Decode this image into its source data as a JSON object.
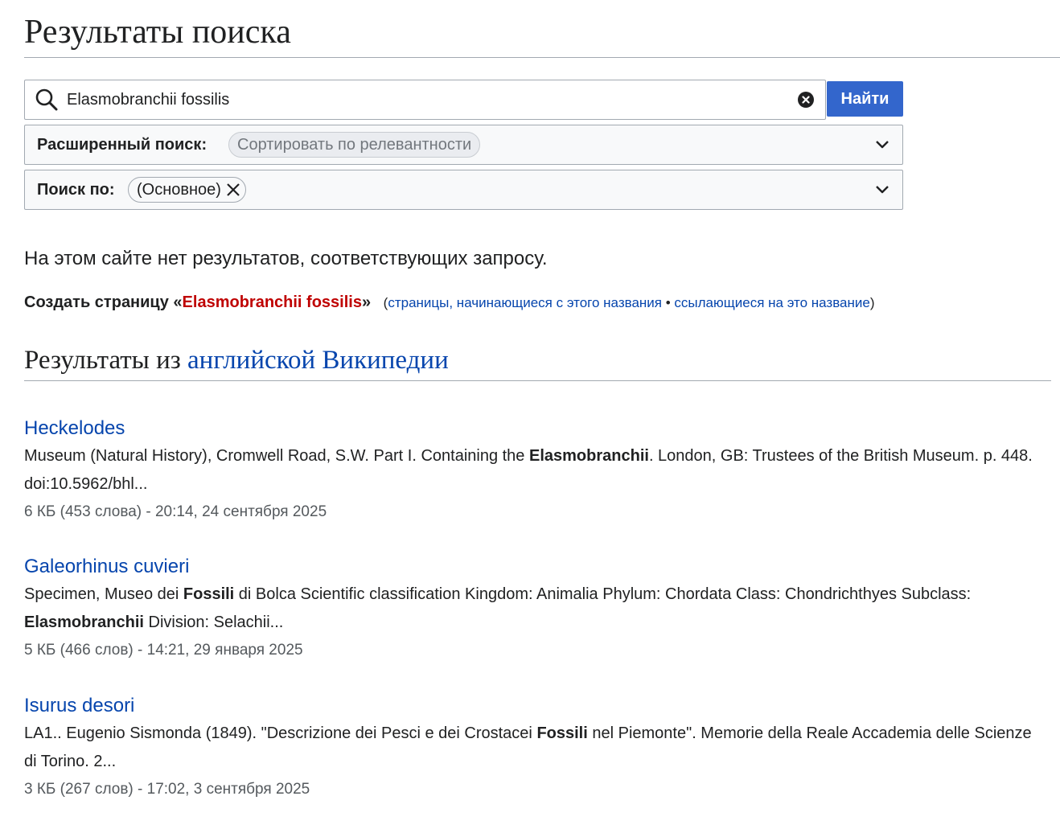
{
  "page": {
    "title": "Результаты поиска"
  },
  "search": {
    "query": "Elasmobranchii fossilis",
    "button_label": "Найти"
  },
  "advanced": {
    "label": "Расширенный поиск:",
    "sort_chip": "Сортировать по релевантности"
  },
  "namespace": {
    "label": "Поиск по:",
    "chip": "(Основное)"
  },
  "notice": {
    "no_results": "На этом сайте нет результатов, соответствующих запросу.",
    "create_prefix": "Создать страницу «",
    "create_title": "Elasmobranchii fossilis",
    "create_suffix": "»",
    "paren_open": "(",
    "link_prefix": "страницы, начинающиеся с этого названия",
    "separator": " • ",
    "link_links": "ссылающиеся на это название",
    "paren_close": ")"
  },
  "interwiki": {
    "prefix": "Результаты из ",
    "link": "английской Википедии"
  },
  "results": [
    {
      "title": "Heckelodes",
      "snippet": [
        {
          "t": "Museum (Natural History), Cromwell Road, S.W. Part I. Containing the ",
          "b": false
        },
        {
          "t": "Elasmobranchii",
          "b": true
        },
        {
          "t": ". London, GB: Trustees of the British Museum. p. 448. doi:10.5962/bhl...",
          "b": false
        }
      ],
      "meta": "6 КБ (453 слова) - 20:14, 24 сентября 2025"
    },
    {
      "title": "Galeorhinus cuvieri",
      "snippet": [
        {
          "t": "Specimen, Museo dei ",
          "b": false
        },
        {
          "t": "Fossili",
          "b": true
        },
        {
          "t": " di Bolca Scientific classification Kingdom: Animalia Phylum: Chordata Class: Chondrichthyes Subclass: ",
          "b": false
        },
        {
          "t": "Elasmobranchii",
          "b": true
        },
        {
          "t": " Division: Selachii...",
          "b": false
        }
      ],
      "meta": "5 КБ (466 слов) - 14:21, 29 января 2025"
    },
    {
      "title": "Isurus desori",
      "snippet": [
        {
          "t": "LA1.. Eugenio Sismonda (1849). \"Descrizione dei Pesci e dei Crostacei ",
          "b": false
        },
        {
          "t": "Fossili",
          "b": true
        },
        {
          "t": " nel Piemonte\". Memorie della Reale Accademia delle Scienze di Torino. 2...",
          "b": false
        }
      ],
      "meta": "3 КБ (267 слов) - 17:02, 3 сентября 2025"
    }
  ]
}
